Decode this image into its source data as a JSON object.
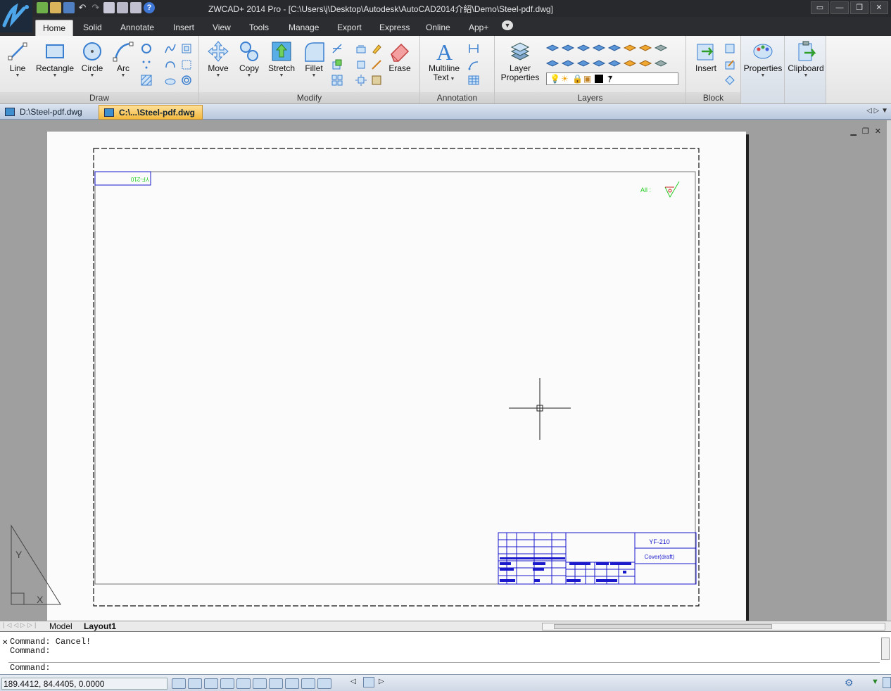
{
  "window": {
    "title": "ZWCAD+ 2014 Pro - [C:\\Users\\j\\Desktop\\Autodesk\\AutoCAD2014介紹\\Demo\\Steel-pdf.dwg]",
    "controls": [
      "▭",
      "—",
      "❐",
      "✕"
    ]
  },
  "ribbon_tabs": [
    "Home",
    "Solid",
    "Annotate",
    "Insert",
    "View",
    "Tools",
    "Manage",
    "Export",
    "Express",
    "Online",
    "App+"
  ],
  "ribbon_active_tab": "Home",
  "panels": {
    "draw": {
      "title": "Draw",
      "buttons": [
        "Line",
        "Rectangle",
        "Circle",
        "Arc"
      ]
    },
    "modify": {
      "title": "Modify",
      "buttons": [
        "Move",
        "Copy",
        "Stretch",
        "Fillet",
        "Erase"
      ]
    },
    "annotation": {
      "title": "Annotation",
      "multiline_line1": "Multiline",
      "multiline_line2": "Text"
    },
    "layers": {
      "title": "Layers",
      "props_line1": "Layer",
      "props_line2": "Properties",
      "current_layer": "7"
    },
    "block": {
      "title": "Block",
      "insert": "Insert"
    },
    "properties": {
      "label": "Properties"
    },
    "clipboard": {
      "label": "Clipboard"
    }
  },
  "doc_tabs": [
    {
      "label": "D:\\Steel-pdf.dwg",
      "active": false
    },
    {
      "label": "C:\\...\\Steel-pdf.dwg",
      "active": true
    }
  ],
  "drawing": {
    "corner_label": "YF-210",
    "all_label": "All :",
    "title_block_code": "YF-210",
    "title_block_name": "Cover(draft)",
    "ucs_y": "Y",
    "ucs_x": "X"
  },
  "layout_tabs": [
    "Model",
    "Layout1"
  ],
  "layout_active": "Layout1",
  "command": {
    "history": [
      "Command: Cancel!",
      "Command:"
    ],
    "prompt": "Command:"
  },
  "status": {
    "coordinates": "189.4412, 84.4405, 0.0000"
  },
  "colors": {
    "title_bar": "#27292d",
    "accent_blue": "#3a7fd0",
    "drawing_blue": "#1a1acc",
    "drawing_green": "#33dd33",
    "active_doc_tab": "#f3b93e"
  }
}
